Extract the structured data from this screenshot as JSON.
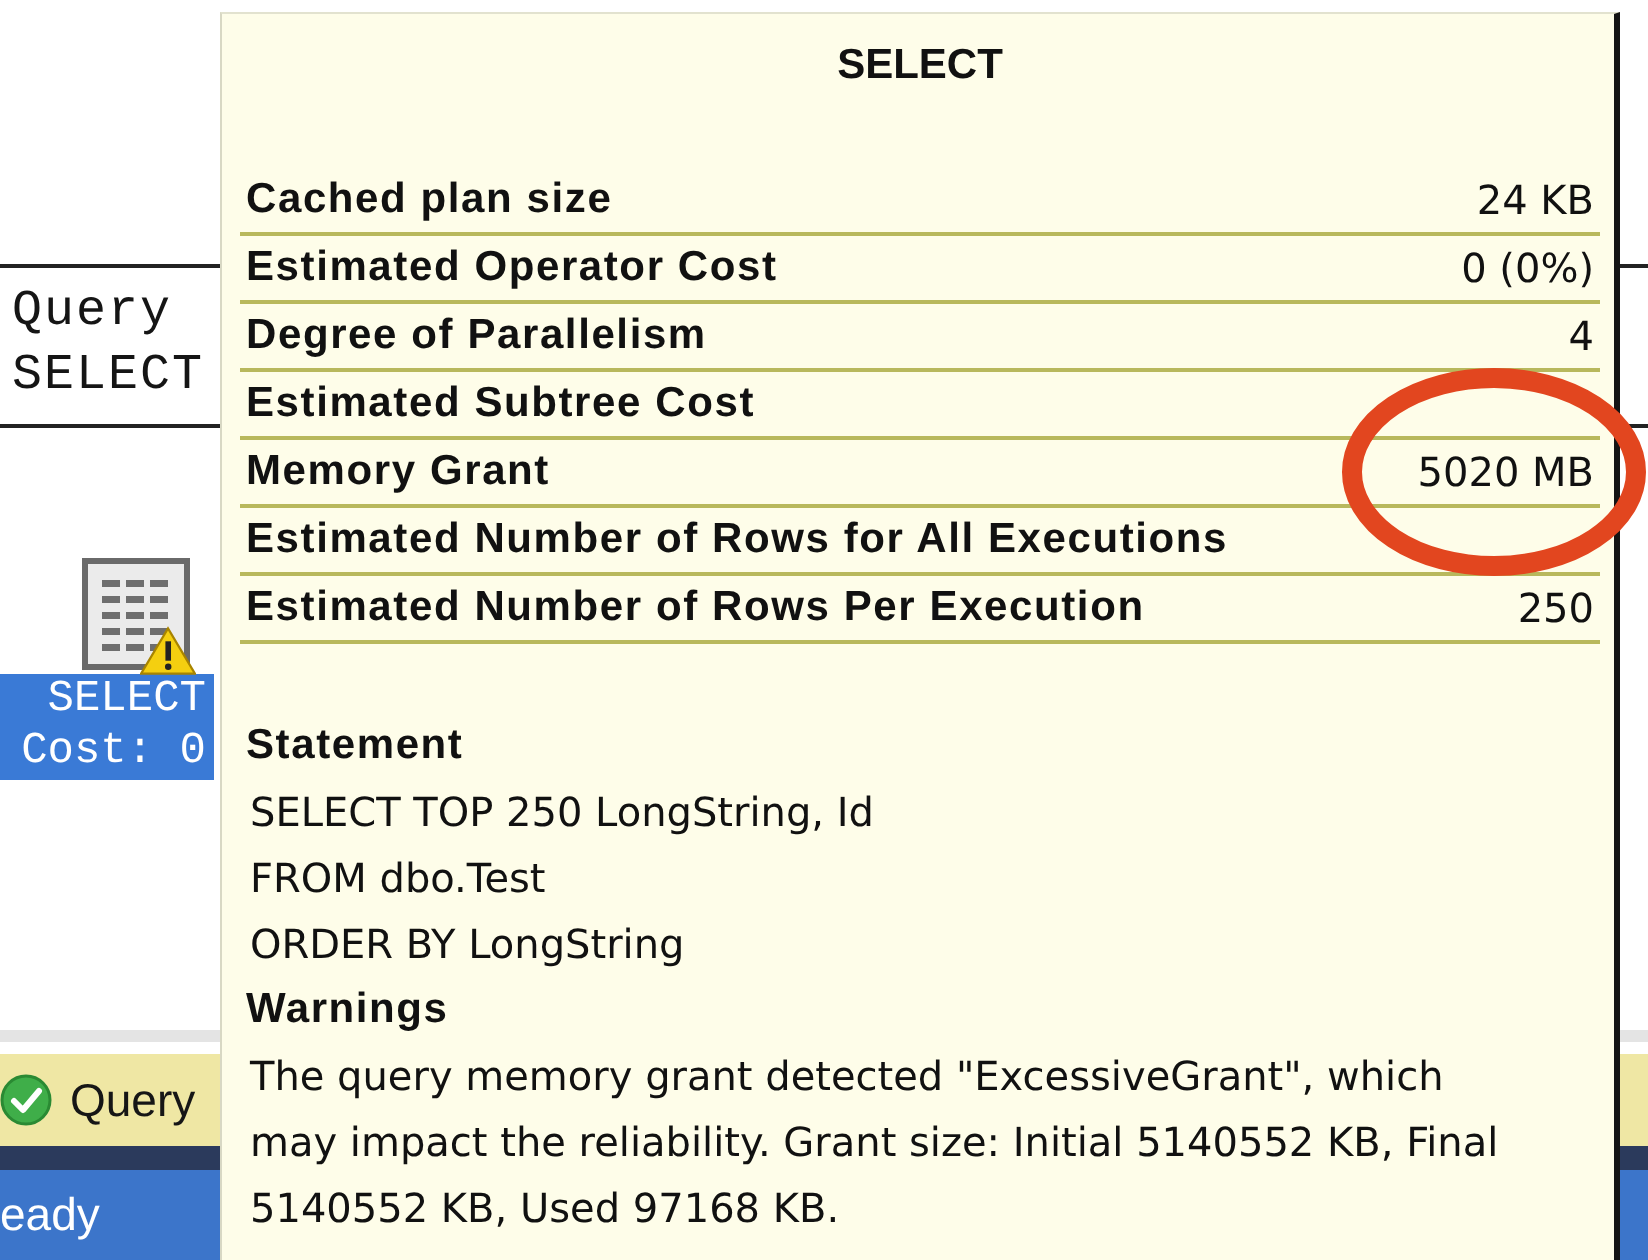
{
  "plan": {
    "query_header": {
      "title": "Query",
      "statement": "SELECT"
    },
    "operator": {
      "name": "SELECT",
      "cost": "Cost: 0",
      "selected": true,
      "warning": true
    }
  },
  "tooltip": {
    "title": "SELECT",
    "properties": [
      {
        "label": "Cached plan size",
        "value": "24 KB"
      },
      {
        "label": "Estimated Operator Cost",
        "value": "0 (0%)"
      },
      {
        "label": "Degree of Parallelism",
        "value": "4"
      },
      {
        "label": "Estimated Subtree Cost"
      },
      {
        "label": "Memory Grant",
        "value": "5020 MB"
      },
      {
        "label": "Estimated Number of Rows for All Executions"
      },
      {
        "label": "Estimated Number of Rows Per Execution",
        "value": "250"
      }
    ],
    "sections": [
      {
        "heading": "Statement",
        "text": "SELECT TOP 250 LongString, Id\nFROM dbo.Test\nORDER BY LongString"
      },
      {
        "heading": "Warnings",
        "text": "The query memory grant detected \"ExcessiveGrant\", which may impact the reliability. Grant size: Initial 5140552 KB, Final 5140552 KB, Used 97168 KB."
      }
    ]
  },
  "query_status": {
    "message": "Query"
  },
  "status_bar": {
    "text": "eady"
  }
}
